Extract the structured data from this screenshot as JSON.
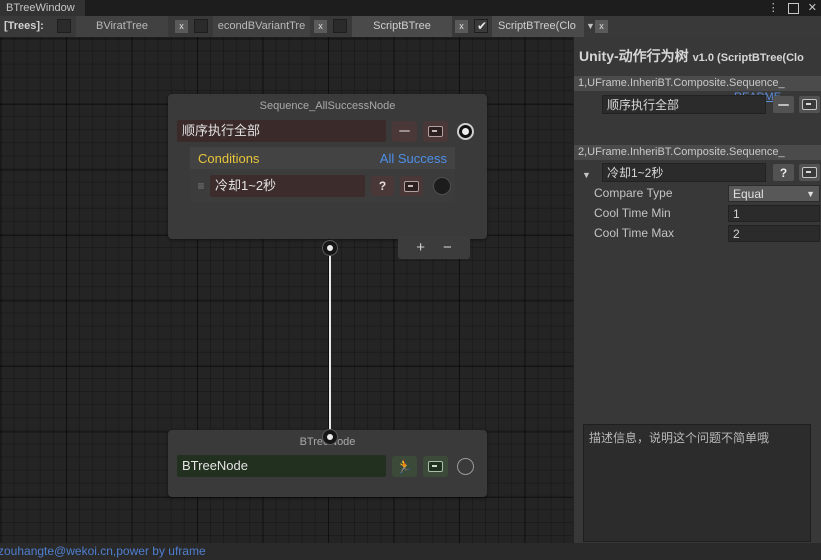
{
  "window": {
    "tab_title": "BTreeWindow",
    "buttons": {
      "menu": "⋮",
      "maximize": "",
      "close": "✕"
    }
  },
  "tabstrip": {
    "trees_label": "[Trees]:",
    "tabs": [
      {
        "label": "BViratTree",
        "close": "x",
        "checked": false
      },
      {
        "label": "econdBVariantTre",
        "close": "x",
        "checked": false
      },
      {
        "label": "ScriptBTree",
        "close": "x",
        "checked": true,
        "check_glyph": "✔"
      },
      {
        "label": "ScriptBTree(Clo",
        "close": "x",
        "caret": "▼"
      }
    ]
  },
  "canvas": {
    "sequence_node": {
      "title": "Sequence_AllSuccessNode",
      "name_value": "顺序执行全部",
      "btn_dash": "dash-icon",
      "btn_screen": "screen-icon",
      "conditions_label": "Conditions",
      "conditions_status": "All Success",
      "condition_row": {
        "handle": "≡",
        "value": "冷却1~2秒",
        "btn_help": "?",
        "btn_screen": "screen-icon"
      },
      "add_label": "+",
      "remove_label": "−"
    },
    "btree_node": {
      "title": "BTreeNode",
      "name_value": "BTreeNode",
      "btn_run": "Ἴ3",
      "btn_screen": "screen-icon"
    }
  },
  "inspector": {
    "title": "Unity-动作行为树",
    "version": "v1.0 (ScriptBTree(Clo",
    "readme": "README",
    "section1": {
      "header": "1,UFrame.InheriBT.Composite.Sequence_",
      "field_value": "顺序执行全部",
      "btn_dash": "dash-icon",
      "btn_screen": "screen-icon"
    },
    "section2": {
      "header": "2,UFrame.InheriBT.Composite.Sequence_",
      "foldout": "▼",
      "field_value": "冷却1~2秒",
      "btn_help": "?",
      "btn_screen": "screen-icon",
      "properties": [
        {
          "label": "Compare Type",
          "value": "Equal",
          "type": "dropdown"
        },
        {
          "label": "Cool Time Min",
          "value": "1",
          "type": "text"
        },
        {
          "label": "Cool Time Max",
          "value": "2",
          "type": "text"
        }
      ]
    },
    "description": "描述信息，说明这个问题不简单哦"
  },
  "statusbar": {
    "text": "zouhangte@wekoi.cn,power by uframe"
  },
  "colors": {
    "accent_yellow": "#e8c53a",
    "accent_blue": "#4d8fe8",
    "link_blue": "#5b8ddb",
    "status_blue": "#4f7fd0"
  }
}
